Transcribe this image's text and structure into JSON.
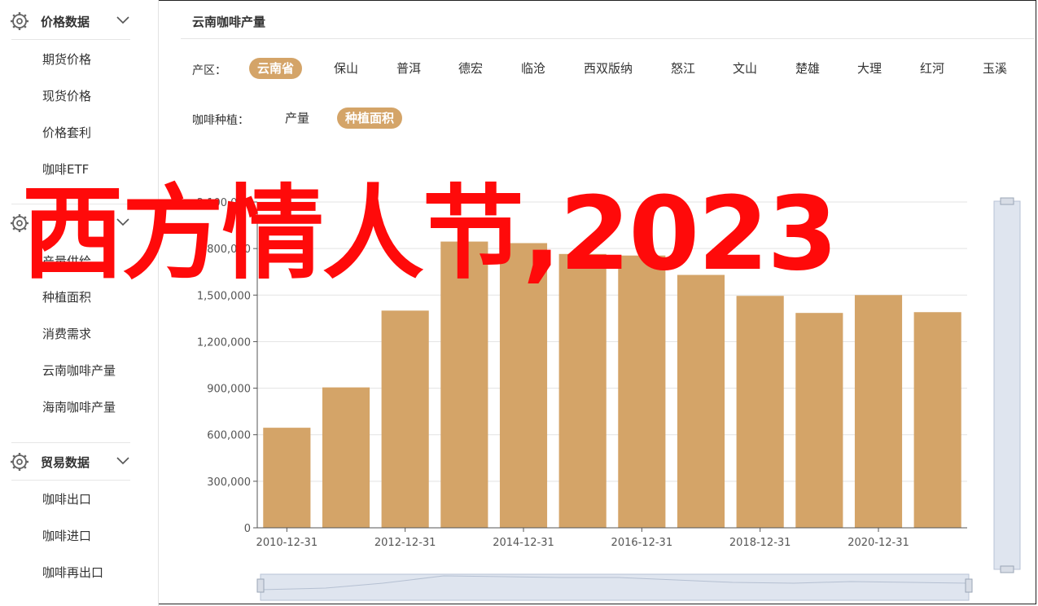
{
  "sidebar": {
    "sections": [
      {
        "title": "价格数据",
        "items": [
          "期货价格",
          "现货价格",
          "价格套利",
          "咖啡ETF"
        ]
      },
      {
        "title": "",
        "items": [
          "产量供给",
          "种植面积",
          "消费需求",
          "云南咖啡产量",
          "海南咖啡产量"
        ]
      },
      {
        "title": "贸易数据",
        "items": [
          "咖啡出口",
          "咖啡进口",
          "咖啡再出口"
        ]
      }
    ]
  },
  "main": {
    "title": "云南咖啡产量",
    "region_label": "产区：",
    "regions": [
      "云南省",
      "保山",
      "普洱",
      "德宏",
      "临沧",
      "西双版纳",
      "怒江",
      "文山",
      "楚雄",
      "大理",
      "红河",
      "玉溪"
    ],
    "active_region": "云南省",
    "kind_label": "咖啡种植：",
    "kinds": [
      "产量",
      "种植面积"
    ],
    "active_kind": "种植面积"
  },
  "overlay": {
    "text": "西方情人节,2023"
  },
  "colors": {
    "accent": "#d4a468",
    "bar": "#d4a468",
    "overlay": "#ff0a0a"
  },
  "chart_data": {
    "type": "bar",
    "categories": [
      "2010-12-31",
      "2011-12-31",
      "2012-12-31",
      "2013-12-31",
      "2014-12-31",
      "2015-12-31",
      "2016-12-31",
      "2017-12-31",
      "2018-12-31",
      "2019-12-31",
      "2020-12-31",
      "2021-12-31"
    ],
    "x_tick_labels": [
      "2010-12-31",
      "2012-12-31",
      "2014-12-31",
      "2016-12-31",
      "2018-12-31",
      "2020-12-31"
    ],
    "values": [
      645000,
      905000,
      1400000,
      1845000,
      1835000,
      1765000,
      1755000,
      1630000,
      1495000,
      1385000,
      1500000,
      1390000
    ],
    "yticks": [
      0,
      300000,
      600000,
      900000,
      1200000,
      1500000,
      1800000,
      2100000
    ],
    "ytick_labels": [
      "0",
      "300,000",
      "600,000",
      "900,000",
      "1,200,000",
      "1,500,000",
      "1,800,000",
      "2,100,000"
    ],
    "ylim": [
      0,
      2100000
    ],
    "grid": true,
    "legend": "none"
  }
}
